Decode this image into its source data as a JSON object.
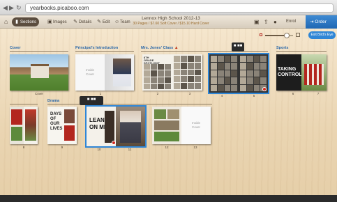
{
  "browser": {
    "url": "yearbooks.picaboo.com",
    "nav_back": "◀",
    "nav_forward": "▶",
    "nav_reload": "↻"
  },
  "toolbar": {
    "home_icon": "⌂",
    "tabs": [
      {
        "icon": "bookmark-icon",
        "glyph": "▮",
        "label": "Sections"
      },
      {
        "icon": "image-icon",
        "glyph": "▣",
        "label": "Images"
      },
      {
        "icon": "details-icon",
        "glyph": "✎",
        "label": "Details"
      },
      {
        "icon": "edit-icon",
        "glyph": "✎",
        "label": "Edit"
      },
      {
        "icon": "team-icon",
        "glyph": "☺",
        "label": "Team"
      }
    ],
    "title": "Lennox High School 2012-13",
    "subtitle": "30 Pages / $7.60 Soft Cover / $15.10 Hard Cover",
    "icons": {
      "save": "▣",
      "share": "⇪",
      "info": "●"
    },
    "enrol_label": "Enrol",
    "order_label": "Order",
    "order_icon": "⇥"
  },
  "view": {
    "zoom_level": 0.78,
    "birdseye_label": "Exit Bird's Eye"
  },
  "sections": [
    {
      "label": "Cover",
      "warning": false
    },
    {
      "label": "Principal's Introduction",
      "warning": false
    },
    {
      "label": "Mrs. Jones' Class",
      "warning": true,
      "lock": true
    },
    {
      "label": "",
      "warning": false
    },
    {
      "label": "Sports",
      "warning": false
    },
    {
      "label": "",
      "warning": false
    },
    {
      "label": "Drama",
      "warning": false
    }
  ],
  "pages": {
    "cover": "Cover",
    "inside_cover": "Inside\nCover",
    "labels": [
      "1",
      "2",
      "3",
      "4",
      "5",
      "6",
      "7",
      "8",
      "9",
      "10",
      "11",
      "12",
      "13"
    ]
  },
  "spread_text": {
    "spotlight_heading": "8TH GRADE SPOTLIGHT",
    "sports_heading_1": "TAKING",
    "sports_heading_2": "CONTROL",
    "drama_heading_1": "DAYS",
    "drama_heading_2": "OF",
    "drama_heading_3": "OUR",
    "drama_heading_4": "LIVES",
    "drama_heading_5": "LEAN",
    "drama_heading_6": "ON ME"
  },
  "tooltip": {
    "glyphs": "■ ■■"
  },
  "colors": {
    "accent": "#2f86d6",
    "toolbar": "#5b4d3f",
    "section_label": "#2a67a8",
    "alert": "#d2281e"
  }
}
